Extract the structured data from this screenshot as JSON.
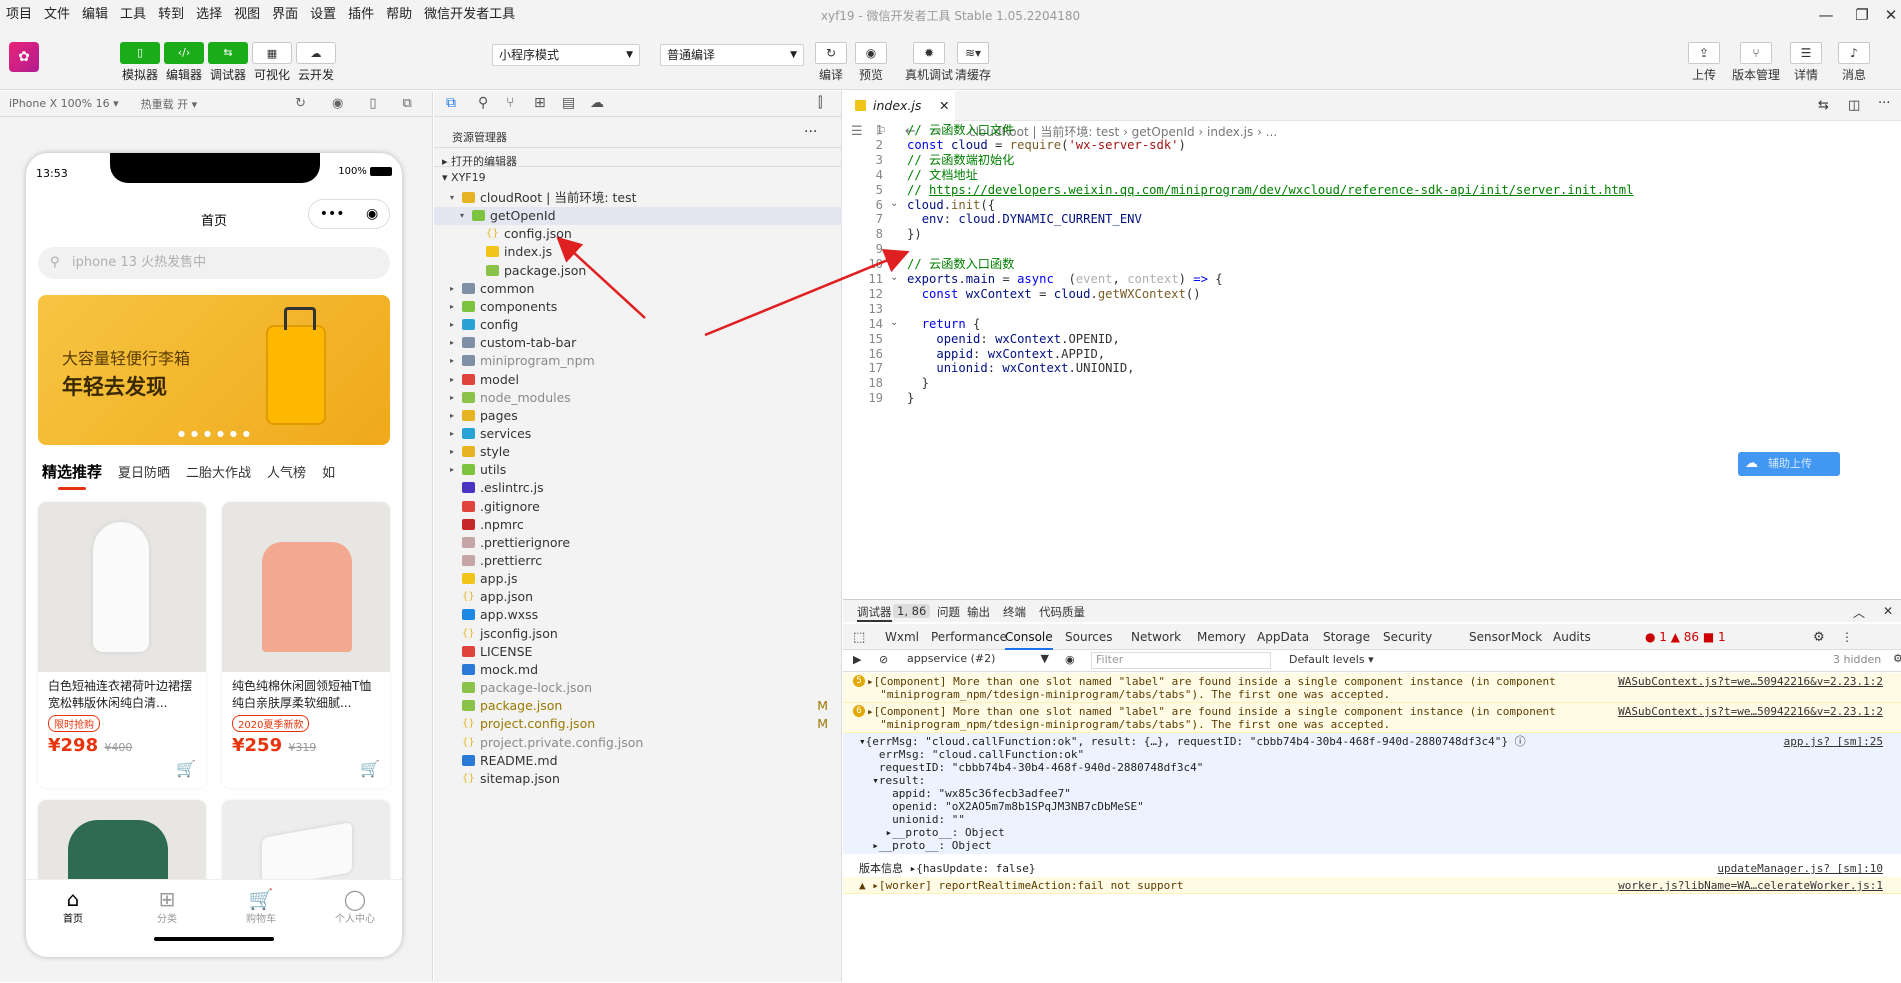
{
  "menu": [
    "项目",
    "文件",
    "编辑",
    "工具",
    "转到",
    "选择",
    "视图",
    "界面",
    "设置",
    "插件",
    "帮助",
    "微信开发者工具"
  ],
  "window_title": "xyf19 - 微信开发者工具 Stable 1.05.2204180",
  "toolbar": {
    "left_buttons": [
      {
        "label": "模拟器",
        "icon": "phone-icon",
        "style": "green"
      },
      {
        "label": "编辑器",
        "icon": "code-icon",
        "style": "green"
      },
      {
        "label": "调试器",
        "icon": "debug-icon",
        "style": "green"
      },
      {
        "label": "可视化",
        "icon": "visual-icon",
        "style": "white"
      },
      {
        "label": "云开发",
        "icon": "cloud-icon",
        "style": "white"
      }
    ],
    "mode_select": "小程序模式",
    "compile_select": "普通编译",
    "mid_buttons": [
      {
        "label": "编译",
        "icon": "refresh-icon"
      },
      {
        "label": "预览",
        "icon": "eye-icon"
      },
      {
        "label": "真机调试",
        "icon": "bug-icon"
      },
      {
        "label": "清缓存",
        "icon": "layers-icon"
      }
    ],
    "right_buttons": [
      {
        "label": "上传",
        "icon": "upload-icon"
      },
      {
        "label": "版本管理",
        "icon": "branch-icon"
      },
      {
        "label": "详情",
        "icon": "menu-icon"
      },
      {
        "label": "消息",
        "icon": "bell-icon"
      }
    ]
  },
  "simulator": {
    "device": "iPhone X 100% 16 ▾",
    "hot_reload": "热重载 开 ▾",
    "time": "13:53",
    "battery": "100%",
    "page_title": "首页",
    "search_placeholder": "iphone 13 火热发售中",
    "banner_line1": "大容量轻便行李箱",
    "banner_line2": "年轻去发现",
    "category_tabs": [
      "精选推荐",
      "夏日防晒",
      "二胎大作战",
      "人气榜",
      "如"
    ],
    "products": [
      {
        "name": "白色短袖连衣裙荷叶边裙摆宽松韩版休闲纯白清...",
        "tag": "限时抢购",
        "price": "¥298",
        "orig": "¥400"
      },
      {
        "name": "纯色纯棉休闲圆领短袖T恤纯白亲肤厚柔软细腻...",
        "tag": "2020夏季新款",
        "price": "¥259",
        "orig": "¥319"
      }
    ],
    "tabbar": [
      "首页",
      "分类",
      "购物车",
      "个人中心"
    ]
  },
  "explorer": {
    "title": "资源管理器",
    "open_editors": "打开的编辑器",
    "project": "XYF19",
    "tree": [
      {
        "name": "cloudRoot | 当前环境: test",
        "indent": 1,
        "arrow": "▾",
        "icon": "folder-open",
        "color": "#e6b422"
      },
      {
        "name": "getOpenId",
        "indent": 2,
        "arrow": "▾",
        "icon": "folder",
        "color": "#7cc33f",
        "sel": true
      },
      {
        "name": "config.json",
        "indent": 3,
        "icon": "json",
        "color": "#e6b422",
        "text": "{}"
      },
      {
        "name": "index.js",
        "indent": 3,
        "icon": "js",
        "color": "#f0c419"
      },
      {
        "name": "package.json",
        "indent": 3,
        "icon": "npm",
        "color": "#8bc34a"
      },
      {
        "name": "common",
        "indent": 1,
        "arrow": "▸",
        "icon": "folder",
        "color": "#7f8fa6"
      },
      {
        "name": "components",
        "indent": 1,
        "arrow": "▸",
        "icon": "folder",
        "color": "#7cc33f"
      },
      {
        "name": "config",
        "indent": 1,
        "arrow": "▸",
        "icon": "folder",
        "color": "#29a3d6"
      },
      {
        "name": "custom-tab-bar",
        "indent": 1,
        "arrow": "▸",
        "icon": "folder",
        "color": "#7f8fa6"
      },
      {
        "name": "miniprogram_npm",
        "indent": 1,
        "arrow": "▸",
        "icon": "folder",
        "color": "#7f8fa6",
        "dim": true
      },
      {
        "name": "model",
        "indent": 1,
        "arrow": "▸",
        "icon": "folder",
        "color": "#e0443e"
      },
      {
        "name": "node_modules",
        "indent": 1,
        "arrow": "▸",
        "icon": "folder",
        "color": "#8bc34a",
        "dim": true
      },
      {
        "name": "pages",
        "indent": 1,
        "arrow": "▸",
        "icon": "folder",
        "color": "#e6b422"
      },
      {
        "name": "services",
        "indent": 1,
        "arrow": "▸",
        "icon": "folder",
        "color": "#29a3d6"
      },
      {
        "name": "style",
        "indent": 1,
        "arrow": "▸",
        "icon": "folder",
        "color": "#e6b422"
      },
      {
        "name": "utils",
        "indent": 1,
        "arrow": "▸",
        "icon": "folder",
        "color": "#7cc33f"
      },
      {
        "name": ".eslintrc.js",
        "indent": 1,
        "icon": "eslint",
        "color": "#4b32c3"
      },
      {
        "name": ".gitignore",
        "indent": 1,
        "icon": "git",
        "color": "#e0443e"
      },
      {
        "name": ".npmrc",
        "indent": 1,
        "icon": "npm",
        "color": "#c62828"
      },
      {
        "name": ".prettierignore",
        "indent": 1,
        "icon": "prettier",
        "color": "#c5a5a5"
      },
      {
        "name": ".prettierrc",
        "indent": 1,
        "icon": "prettier",
        "color": "#c5a5a5"
      },
      {
        "name": "app.js",
        "indent": 1,
        "icon": "js",
        "color": "#f0c419"
      },
      {
        "name": "app.json",
        "indent": 1,
        "icon": "json",
        "color": "#e6b422",
        "text": "{}"
      },
      {
        "name": "app.wxss",
        "indent": 1,
        "icon": "css",
        "color": "#1e88e5"
      },
      {
        "name": "jsconfig.json",
        "indent": 1,
        "icon": "json",
        "color": "#e6b422",
        "text": "{}"
      },
      {
        "name": "LICENSE",
        "indent": 1,
        "icon": "license",
        "color": "#e0443e"
      },
      {
        "name": "mock.md",
        "indent": 1,
        "icon": "md",
        "color": "#2b7bd6"
      },
      {
        "name": "package-lock.json",
        "indent": 1,
        "icon": "npm",
        "color": "#8bc34a",
        "dim": true
      },
      {
        "name": "package.json",
        "indent": 1,
        "icon": "npm",
        "color": "#8bc34a",
        "badge": "M",
        "mod": true
      },
      {
        "name": "project.config.json",
        "indent": 1,
        "icon": "json",
        "color": "#e6b422",
        "text": "{}",
        "badge": "M",
        "mod": true
      },
      {
        "name": "project.private.config.json",
        "indent": 1,
        "icon": "json",
        "color": "#e6b422",
        "text": "{}",
        "dim": true
      },
      {
        "name": "README.md",
        "indent": 1,
        "icon": "info",
        "color": "#2b7bd6"
      },
      {
        "name": "sitemap.json",
        "indent": 1,
        "icon": "json",
        "color": "#e6b422",
        "text": "{}"
      }
    ]
  },
  "editor": {
    "tab": "index.js",
    "breadcrumb": "cloudRoot | 当前环境: test  ›  getOpenId  ›  index.js  › ...",
    "cloud_badge": "辅助上传"
  },
  "console": {
    "top_tabs": [
      "调试器",
      "1, 86",
      "问题",
      "输出",
      "终端",
      "代码质量"
    ],
    "devtools_tabs": [
      "Wxml",
      "Performance",
      "Console",
      "Sources",
      "Network",
      "Memory",
      "AppData",
      "Storage",
      "Security",
      "Sensor",
      "Mock",
      "Audits"
    ],
    "active_tab": "Console",
    "counts": "● 1  ▲ 86  ■ 1",
    "context": "appservice (#2)",
    "filter_placeholder": "Filter",
    "levels": "Default levels ▾",
    "hidden": "3 hidden",
    "logs": [
      {
        "type": "warn",
        "num": "5",
        "text": "▸[Component] More than one slot named \"label\" are found inside a single component instance (in component\n  \"miniprogram_npm/tdesign-miniprogram/tabs/tabs\"). The first one was accepted.",
        "src": "WASubContext.js?t=we…50942216&v=2.23.1:2"
      },
      {
        "type": "warn",
        "num": "6",
        "text": "▸[Component] More than one slot named \"label\" are found inside a single component instance (in component\n  \"miniprogram_npm/tdesign-miniprogram/tabs/tabs\"). The first one was accepted.",
        "src": "WASubContext.js?t=we…50942216&v=2.23.1:2"
      },
      {
        "type": "info",
        "text": "▾{errMsg: \"cloud.callFunction:ok\", result: {…}, requestID: \"cbbb74b4-30b4-468f-940d-2880748df3c4\"} ⓘ\n   errMsg: \"cloud.callFunction:ok\"\n   requestID: \"cbbb74b4-30b4-468f-940d-2880748df3c4\"\n  ▾result:\n     appid: \"wx85c36fecb3adfee7\"\n     openid: \"oX2AO5m7m8b1SPqJM3NB7cDbMeSE\"\n     unionid: \"\"\n    ▸__proto__: Object\n  ▸__proto__: Object",
        "src": "app.js? [sm]:25"
      },
      {
        "type": "plain",
        "text": "版本信息 ▸{hasUpdate: false}",
        "src": "updateManager.js? [sm]:10"
      },
      {
        "type": "warn",
        "text": "▲ ▸[worker] reportRealtimeAction:fail not support",
        "src": "worker.js?libName=WA…celerateWorker.js:1"
      }
    ]
  }
}
